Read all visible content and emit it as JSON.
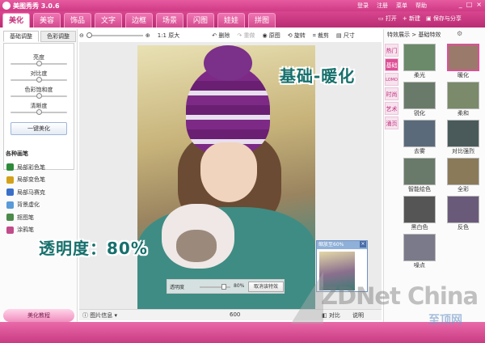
{
  "titlebar": {
    "title": "美图秀秀 3.0.6",
    "links": [
      "登录",
      "注册",
      "菜单",
      "帮助"
    ],
    "buttons": [
      "_",
      "□",
      "×"
    ]
  },
  "nav": {
    "tabs": [
      "美化",
      "美容",
      "饰品",
      "文字",
      "边框",
      "场景",
      "闪图",
      "娃娃",
      "拼图"
    ],
    "active": "美化",
    "open_label": "打开",
    "new_label": "新建",
    "save_label": "保存与分享"
  },
  "left_panel": {
    "tabs": [
      "基础调整",
      "色彩调整"
    ],
    "sliders": [
      {
        "label": "亮度",
        "value": 0.5
      },
      {
        "label": "对比度",
        "value": 0.5
      },
      {
        "label": "色彩饱和度",
        "value": 0.5
      },
      {
        "label": "清晰度",
        "value": 0.5
      }
    ],
    "beautify_button": "一键美化",
    "brushes_title": "各种画笔",
    "brushes": [
      {
        "label": "局部彩色笔",
        "color": "#2e8b3a"
      },
      {
        "label": "局部变色笔",
        "color": "#d4a11a"
      },
      {
        "label": "局部马赛克",
        "color": "#3a6fc9"
      },
      {
        "label": "背景虚化",
        "color": "#5a9ad8"
      },
      {
        "label": "抠图笔",
        "color": "#4b8a4b"
      },
      {
        "label": "涂鸦笔",
        "color": "#c24b8a"
      }
    ],
    "tutorial_button": "美化教程"
  },
  "toolbar": {
    "original_size": "1:1 原大",
    "delete": "删除",
    "redo": "重做",
    "original": "原图",
    "rotate": "旋转",
    "crop": "裁剪",
    "resize": "尺寸"
  },
  "status": {
    "image_info": "图片信息",
    "size": "600",
    "compare": "对比",
    "info": "说明"
  },
  "right_panel": {
    "title": "特效展示 > 基础特效",
    "categories": [
      "热门",
      "基础",
      "LOMO",
      "时尚",
      "艺术",
      "涌页"
    ],
    "active_category": "基础",
    "effects": [
      {
        "label": "柔光",
        "color": "#6a8a6a"
      },
      {
        "label": "暖化",
        "color": "#9a7a6a",
        "selected": true
      },
      {
        "label": "锐化",
        "color": "#6a7a6a"
      },
      {
        "label": "柔和",
        "color": "#7a8a6a"
      },
      {
        "label": "去雾",
        "color": "#5a6a7a"
      },
      {
        "label": "对比强烈",
        "color": "#4a5a5a"
      },
      {
        "label": "智能绘色",
        "color": "#6a7a6a"
      },
      {
        "label": "全彩",
        "color": "#8a7a5a"
      },
      {
        "label": "黑白色",
        "color": "#555555"
      },
      {
        "label": "反色",
        "color": "#6a5a7a"
      },
      {
        "label": "噪点",
        "color": "#7a7a8a"
      }
    ]
  },
  "zoom_popup": {
    "title": "缩放至60%"
  },
  "transparency_bar": {
    "label": "透明度",
    "value": 0.8,
    "value_label": "80%",
    "cancel_button": "取消该特效"
  },
  "callouts": {
    "effect": "基础-暖化",
    "opacity": "透明度：80%"
  },
  "watermark": {
    "line1": "ZDNet China",
    "line2": "至顶网"
  }
}
